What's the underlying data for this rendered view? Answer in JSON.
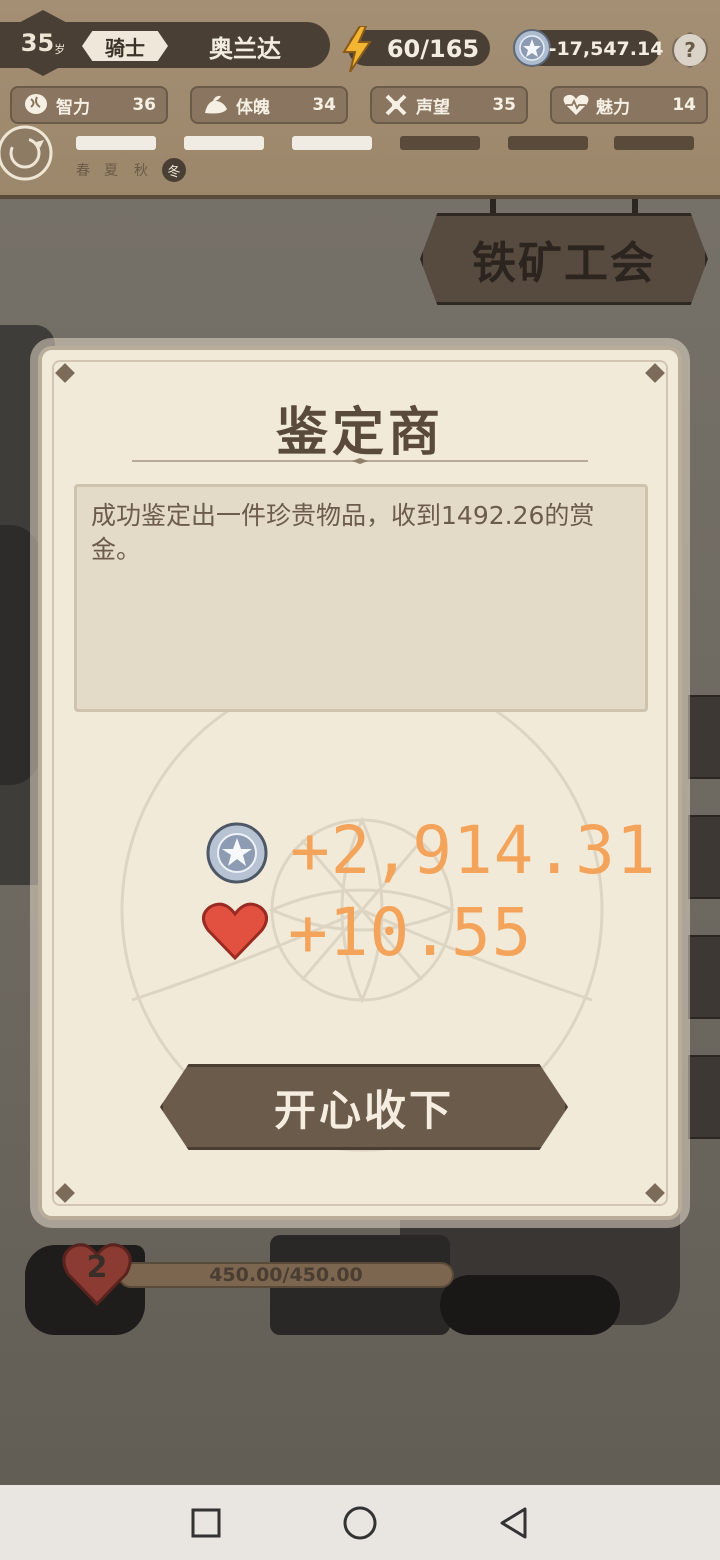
{
  "hud": {
    "age": "35",
    "age_unit": "岁",
    "title": "骑士",
    "player_name": "奥兰达",
    "energy": "60/165",
    "money": "-17,547.14",
    "help": "?",
    "stats": [
      {
        "label": "智力",
        "value": "36",
        "icon": "brain-icon"
      },
      {
        "label": "体魄",
        "value": "34",
        "icon": "muscle-icon"
      },
      {
        "label": "声望",
        "value": "35",
        "icon": "reputation-icon"
      },
      {
        "label": "魅力",
        "value": "14",
        "icon": "heartbeat-icon"
      }
    ],
    "seasons": [
      "春",
      "夏",
      "秋",
      "冬"
    ],
    "current_season": "冬"
  },
  "scene": {
    "shop_sign": "铁矿工会"
  },
  "dialog": {
    "title": "鉴定商",
    "message": "成功鉴定出一件珍贵物品，收到1492.26的赏金。",
    "reward_money": "+2,914.31",
    "reward_charm": "+10.55",
    "accept_label": "开心收下"
  },
  "health": {
    "level": "2",
    "value": "450.00/450.00",
    "fill_fraction": 1.0
  },
  "colors": {
    "reward_text": "#f3a45a",
    "hud_dark": "#4a3f35",
    "dialog_bg": "#f1ead9"
  }
}
